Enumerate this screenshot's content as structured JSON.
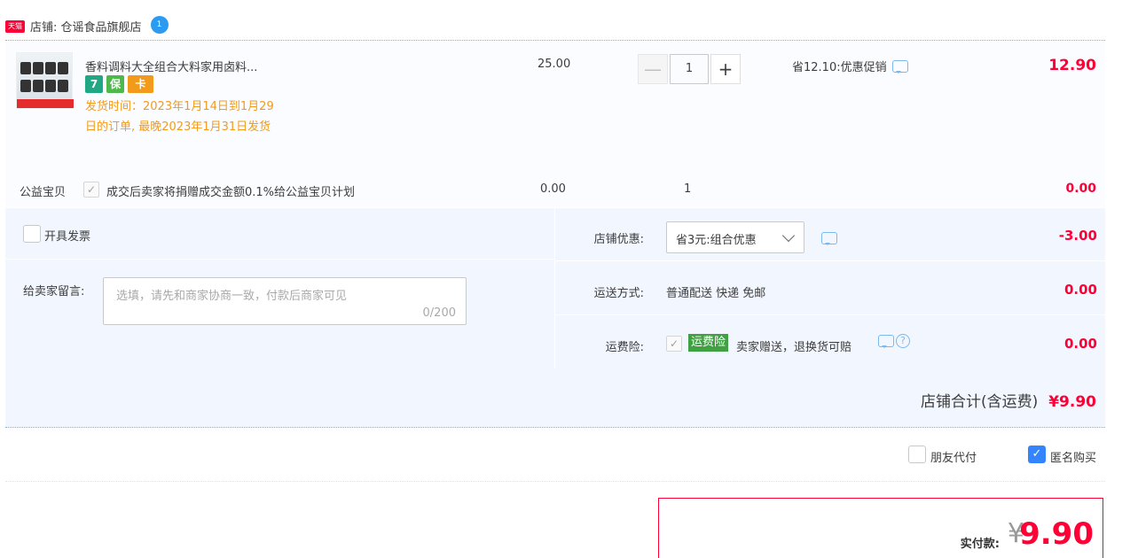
{
  "shop": {
    "logo_text": "天猫",
    "label": "店铺: 仓谣食品旗舰店",
    "wangwang_badge": "1"
  },
  "item": {
    "title": "香料调料大全组合大料家用卤料...",
    "badges": [
      "7",
      "保",
      "卡"
    ],
    "shipping_note": "发货时间：2023年1月14日到1月29日的订单, 最晚2023年1月31日发货",
    "unit_price": "25.00",
    "quantity": "1",
    "minus_label": "—",
    "plus_label": "+",
    "promo_text": "省12.10:优惠促销",
    "total": "12.90"
  },
  "charity": {
    "label": "公益宝贝",
    "text": "成交后卖家将捐赠成交金额0.1%给公益宝贝计划",
    "price": "0.00",
    "quantity": "1",
    "total": "0.00"
  },
  "invoice": {
    "label": "开具发票"
  },
  "memo": {
    "label": "给卖家留言:",
    "placeholder": "选填，请先和商家协商一致，付款后商家可见",
    "count": "0/200"
  },
  "shop_discount": {
    "label": "店铺优惠:",
    "selected": "省3元:组合优惠",
    "value": "-3.00"
  },
  "shipping": {
    "label": "运送方式:",
    "value": "普通配送 快递 免邮",
    "amount": "0.00"
  },
  "insurance": {
    "label": "运费险:",
    "tag": "运费险",
    "text": "卖家赠送，退换货可赔",
    "amount": "0.00"
  },
  "subtotal": {
    "label": "店铺合计(含运费)",
    "value": "¥9.90"
  },
  "options": {
    "friend_pay": "朋友代付",
    "anonymous": "匿名购买",
    "anonymous_checked": true
  },
  "payment": {
    "label": "实付款:",
    "currency": "¥",
    "amount": "9.90"
  },
  "colors": {
    "price_red": "#ff0036",
    "note_orange": "#f29b1b",
    "panel_blue": "#f2f7ff",
    "accent_blue": "#3385ff"
  },
  "icons": [
    "tmall-logo",
    "wangwang-icon",
    "chat-icon",
    "help-icon",
    "chevron-down-icon",
    "check-icon"
  ]
}
